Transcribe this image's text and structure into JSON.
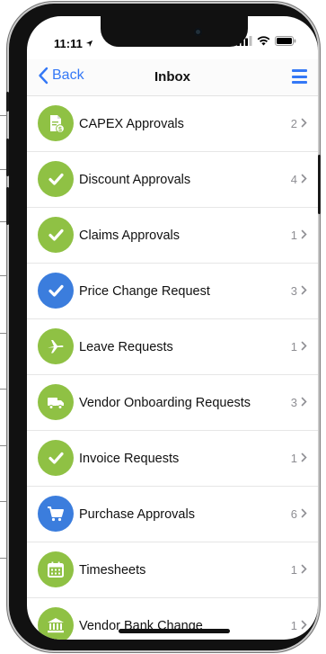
{
  "status_bar": {
    "time": "11:11"
  },
  "nav": {
    "back_label": "Back",
    "title": "Inbox"
  },
  "colors": {
    "green": "#8fc144",
    "blue": "#3b7ddd",
    "accent": "#3478f6"
  },
  "items": [
    {
      "label": "CAPEX Approvals",
      "count": "2",
      "icon": "document-badge-icon",
      "color": "green"
    },
    {
      "label": "Discount Approvals",
      "count": "4",
      "icon": "checkmark-icon",
      "color": "green"
    },
    {
      "label": "Claims Approvals",
      "count": "1",
      "icon": "checkmark-icon",
      "color": "green"
    },
    {
      "label": "Price Change Request",
      "count": "3",
      "icon": "checkmark-icon",
      "color": "blue"
    },
    {
      "label": "Leave Requests",
      "count": "1",
      "icon": "airplane-icon",
      "color": "green"
    },
    {
      "label": "Vendor Onboarding Requests",
      "count": "3",
      "icon": "truck-icon",
      "color": "green"
    },
    {
      "label": "Invoice Requests",
      "count": "1",
      "icon": "checkmark-icon",
      "color": "green"
    },
    {
      "label": "Purchase Approvals",
      "count": "6",
      "icon": "cart-icon",
      "color": "blue"
    },
    {
      "label": "Timesheets",
      "count": "1",
      "icon": "calendar-icon",
      "color": "green"
    },
    {
      "label": "Vendor Bank Change",
      "count": "1",
      "icon": "bank-icon",
      "color": "green"
    }
  ]
}
